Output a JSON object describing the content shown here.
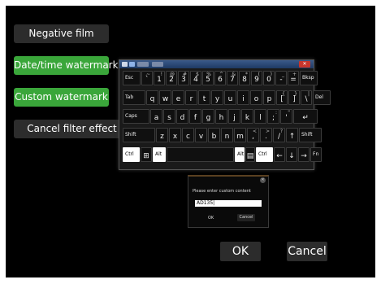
{
  "menu": {
    "negative_film": "Negative film",
    "date_time_watermark": "Date/time watermark",
    "custom_watermark": "Custom watermark",
    "cancel_filter_effect": "Cancel filter effect"
  },
  "colors": {
    "selected": "#3aa63a",
    "button": "#2c2c2c",
    "background": "#000000",
    "frame": "#ffffff"
  },
  "keyboard": {
    "close_icon": "close-icon",
    "rows": [
      [
        {
          "main": "Esc",
          "top": "",
          "name": "key-esc"
        },
        {
          "main": "`",
          "top": "~",
          "name": "key-backtick"
        },
        {
          "main": "1",
          "top": "!",
          "name": "key-1"
        },
        {
          "main": "2",
          "top": "@",
          "name": "key-2"
        },
        {
          "main": "3",
          "top": "#",
          "name": "key-3"
        },
        {
          "main": "4",
          "top": "$",
          "name": "key-4"
        },
        {
          "main": "5",
          "top": "%",
          "name": "key-5"
        },
        {
          "main": "6",
          "top": "^",
          "name": "key-6"
        },
        {
          "main": "7",
          "top": "&",
          "name": "key-7"
        },
        {
          "main": "8",
          "top": "*",
          "name": "key-8"
        },
        {
          "main": "9",
          "top": "(",
          "name": "key-9"
        },
        {
          "main": "0",
          "top": ")",
          "name": "key-0"
        },
        {
          "main": "-",
          "top": "_",
          "name": "key-minus"
        },
        {
          "main": "=",
          "top": "+",
          "name": "key-equals"
        },
        {
          "main": "Bksp",
          "top": "",
          "name": "key-backspace"
        }
      ],
      [
        {
          "main": "Tab",
          "top": "",
          "name": "key-tab"
        },
        {
          "main": "q",
          "top": "",
          "name": "key-q"
        },
        {
          "main": "w",
          "top": "",
          "name": "key-w"
        },
        {
          "main": "e",
          "top": "",
          "name": "key-e"
        },
        {
          "main": "r",
          "top": "",
          "name": "key-r"
        },
        {
          "main": "t",
          "top": "",
          "name": "key-t"
        },
        {
          "main": "y",
          "top": "",
          "name": "key-y"
        },
        {
          "main": "u",
          "top": "",
          "name": "key-u"
        },
        {
          "main": "i",
          "top": "",
          "name": "key-i"
        },
        {
          "main": "o",
          "top": "",
          "name": "key-o"
        },
        {
          "main": "p",
          "top": "",
          "name": "key-p"
        },
        {
          "main": "[",
          "top": "{",
          "name": "key-lbracket"
        },
        {
          "main": "]",
          "top": "}",
          "name": "key-rbracket"
        },
        {
          "main": "\\",
          "top": "|",
          "name": "key-backslash"
        },
        {
          "main": "Del",
          "top": "",
          "name": "key-del"
        }
      ],
      [
        {
          "main": "Caps",
          "top": "",
          "name": "key-caps"
        },
        {
          "main": "a",
          "top": "",
          "name": "key-a"
        },
        {
          "main": "s",
          "top": "",
          "name": "key-s"
        },
        {
          "main": "d",
          "top": "",
          "name": "key-d"
        },
        {
          "main": "f",
          "top": "",
          "name": "key-f"
        },
        {
          "main": "g",
          "top": "",
          "name": "key-g"
        },
        {
          "main": "h",
          "top": "",
          "name": "key-h"
        },
        {
          "main": "j",
          "top": "",
          "name": "key-j"
        },
        {
          "main": "k",
          "top": "",
          "name": "key-k"
        },
        {
          "main": "l",
          "top": "",
          "name": "key-l"
        },
        {
          "main": ";",
          "top": ":",
          "name": "key-semicolon"
        },
        {
          "main": "'",
          "top": "\"",
          "name": "key-quote"
        },
        {
          "main": "↵",
          "top": "",
          "name": "key-enter"
        }
      ],
      [
        {
          "main": "Shift",
          "top": "",
          "name": "key-shift-left"
        },
        {
          "main": "z",
          "top": "",
          "name": "key-z"
        },
        {
          "main": "x",
          "top": "",
          "name": "key-x"
        },
        {
          "main": "c",
          "top": "",
          "name": "key-c"
        },
        {
          "main": "v",
          "top": "",
          "name": "key-v"
        },
        {
          "main": "b",
          "top": "",
          "name": "key-b"
        },
        {
          "main": "n",
          "top": "",
          "name": "key-n"
        },
        {
          "main": "m",
          "top": "",
          "name": "key-m"
        },
        {
          "main": ",",
          "top": "<",
          "name": "key-comma"
        },
        {
          "main": ".",
          "top": ">",
          "name": "key-period"
        },
        {
          "main": "/",
          "top": "?",
          "name": "key-slash"
        },
        {
          "main": "↑",
          "top": "",
          "name": "key-up"
        },
        {
          "main": "Shift",
          "top": "",
          "name": "key-shift-right"
        }
      ],
      [
        {
          "main": "Ctrl",
          "top": "",
          "name": "key-ctrl-left",
          "white": true
        },
        {
          "main": "⊞",
          "top": "",
          "name": "key-win"
        },
        {
          "main": "Alt",
          "top": "",
          "name": "key-alt-left",
          "white": true
        },
        {
          "main": "",
          "top": "",
          "name": "key-space"
        },
        {
          "main": "Alt",
          "top": "",
          "name": "key-alt-right",
          "white": true
        },
        {
          "main": "▤",
          "top": "",
          "name": "key-menu"
        },
        {
          "main": "Ctrl",
          "top": "",
          "name": "key-ctrl-right",
          "white": true
        },
        {
          "main": "←",
          "top": "",
          "name": "key-left"
        },
        {
          "main": "↓",
          "top": "",
          "name": "key-down"
        },
        {
          "main": "→",
          "top": "",
          "name": "key-right"
        },
        {
          "main": "Fn",
          "top": "",
          "name": "key-fn"
        }
      ]
    ]
  },
  "dialog": {
    "title": "Please enter custom content",
    "input_value": "AD135|",
    "ok_label": "OK",
    "cancel_label": "Cancel"
  },
  "footer": {
    "ok_label": "OK",
    "cancel_label": "Cancel"
  }
}
